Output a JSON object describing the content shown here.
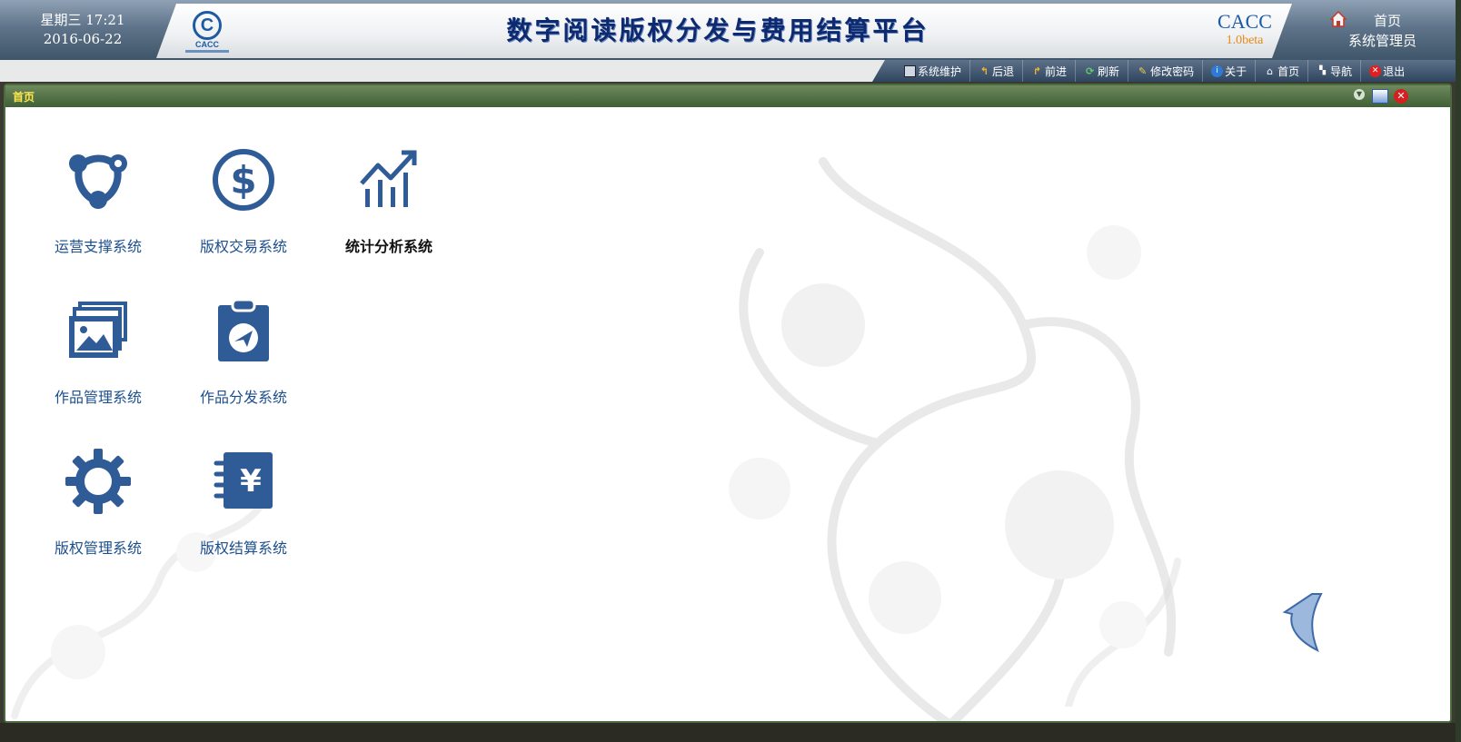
{
  "header": {
    "weekday_time": "星期三 17:21",
    "date": "2016-06-22",
    "logo_text": "CACC",
    "title": "数字阅读版权分发与费用结算平台",
    "brand": "CACC",
    "version": "1.0beta",
    "home_link": "首页",
    "user": "系统管理员"
  },
  "toolbar": {
    "items": [
      {
        "label": "系统维护",
        "icon": "monitor-icon"
      },
      {
        "label": "后退",
        "icon": "back-arrow-icon"
      },
      {
        "label": "前进",
        "icon": "forward-arrow-icon"
      },
      {
        "label": "刷新",
        "icon": "refresh-icon"
      },
      {
        "label": "修改密码",
        "icon": "key-icon"
      },
      {
        "label": "关于",
        "icon": "info-icon"
      },
      {
        "label": "首页",
        "icon": "home-icon"
      },
      {
        "label": "导航",
        "icon": "sitemap-icon"
      },
      {
        "label": "退出",
        "icon": "exit-icon"
      }
    ]
  },
  "panel": {
    "title": "首页"
  },
  "apps": [
    {
      "label": "运营支撑系统",
      "icon": "share-nodes-icon"
    },
    {
      "label": "版权交易系统",
      "icon": "dollar-circle-icon"
    },
    {
      "label": "统计分析系统",
      "icon": "trend-chart-icon"
    },
    {
      "label": "作品管理系统",
      "icon": "images-icon"
    },
    {
      "label": "作品分发系统",
      "icon": "clipboard-send-icon"
    },
    {
      "label": "版权管理系统",
      "icon": "gear-icon"
    },
    {
      "label": "版权结算系统",
      "icon": "yen-notebook-icon"
    }
  ],
  "colors": {
    "header_blue": "#5f748a",
    "panel_green": "#3f5f35",
    "panel_title": "#ffe84c",
    "icon_blue": "#2f5b96",
    "label_blue": "#1d4f8e"
  }
}
